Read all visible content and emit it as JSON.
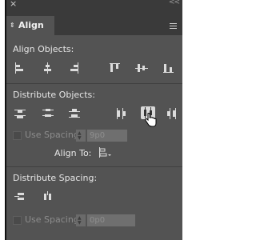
{
  "window": {
    "close_glyph": "×",
    "collapse_glyph": "<<"
  },
  "tab": {
    "label": "Align",
    "arrows_glyph": "⇕"
  },
  "align_objects": {
    "title": "Align Objects:",
    "icons": [
      "align-left-edges-icon",
      "align-horizontal-centers-icon",
      "align-right-edges-icon",
      "align-top-edges-icon",
      "align-vertical-centers-icon",
      "align-bottom-edges-icon"
    ]
  },
  "distribute_objects": {
    "title": "Distribute Objects:",
    "icons": [
      "distribute-top-edges-icon",
      "distribute-vertical-centers-icon",
      "distribute-bottom-edges-icon",
      "distribute-left-edges-icon",
      "distribute-horizontal-centers-icon",
      "distribute-right-edges-icon"
    ],
    "selected_icon": "distribute-horizontal-centers-icon",
    "use_spacing_label": "Use Spacing",
    "use_spacing_checked": false,
    "spacing_value": "9p0",
    "align_to_label": "Align To:"
  },
  "distribute_spacing": {
    "title": "Distribute Spacing:",
    "icons": [
      "distribute-vertical-space-icon",
      "distribute-horizontal-space-icon"
    ],
    "use_spacing_label": "Use Spacing",
    "use_spacing_checked": false,
    "spacing_value": "0p0"
  },
  "colors": {
    "panel_bg": "#535353",
    "header_bg": "#3a3a3a",
    "text": "#e6e6e6",
    "disabled_text": "#8c8c8c",
    "selected_button": "#d9d9d9"
  }
}
